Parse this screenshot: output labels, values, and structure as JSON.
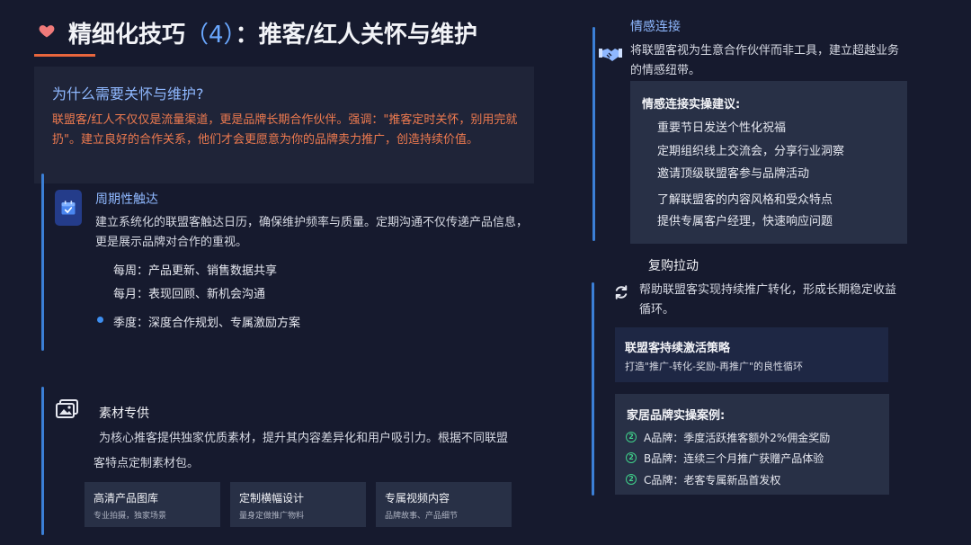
{
  "title": {
    "prefix": "精细化技巧",
    "number": "（4）",
    "suffix": "：推客/红人关怀与维护"
  },
  "why": {
    "heading": "为什么需要关怀与维护?",
    "text": "联盟客/红人不仅仅是流量渠道，更是品牌长期合作伙伴。强调：\"推客定时关怀，别用完就扔\"。建立良好的合作关系，他们才会更愿意为你的品牌卖力推广，创造持续价值。"
  },
  "periodic": {
    "heading": "周期性触达",
    "text": "建立系统化的联盟客触达日历，确保维护频率与质量。定期沟通不仅传递产品信息，更是展示品牌对合作的重视。",
    "items": [
      "每周：产品更新、销售数据共享",
      "每月：表现回顾、新机会沟通",
      "季度：深度合作规划、专属激励方案"
    ]
  },
  "materials": {
    "heading": "素材专供",
    "text_line1": "为核心推客提供独家优质素材，提升其内容差异化和用户吸引力。根据不同联盟",
    "text_line2": "客特点定制素材包。",
    "tiles": [
      {
        "title": "高清产品图库",
        "sub": "专业拍摄，独家场景"
      },
      {
        "title": "定制横幅设计",
        "sub": "量身定做推广物料"
      },
      {
        "title": "专属视频内容",
        "sub": "品牌故事、产品细节"
      }
    ]
  },
  "emotion": {
    "heading": "情感连接",
    "text": "将联盟客视为生意合作伙伴而非工具，建立超越业务的情感纽带。",
    "panel_title": "情感连接实操建议:",
    "items": [
      "重要节日发送个性化祝福",
      "定期组织线上交流会，分享行业洞察",
      "邀请顶级联盟客参与品牌活动",
      "了解联盟客的内容风格和受众特点",
      "提供专属客户经理，快速响应问题"
    ]
  },
  "repurchase": {
    "heading": "复购拉动",
    "text": "帮助联盟客实现持续推广转化，形成长期稳定收益循环。",
    "strategy_title": "联盟客持续激活策略",
    "strategy_text": "打造\"推广-转化-奖励-再推广\"的良性循环",
    "case_title": "家居品牌实操案例:",
    "cases": [
      "A品牌：季度活跃推客额外2%佣金奖励",
      "B品牌：连续三个月推广获赠产品体验",
      "C品牌：老客专属新品首发权"
    ]
  },
  "colors": {
    "background": "#161a2e",
    "accent_blue": "#3b7fd6",
    "accent_orange": "#e8663d",
    "check_green": "#3fd08a"
  }
}
